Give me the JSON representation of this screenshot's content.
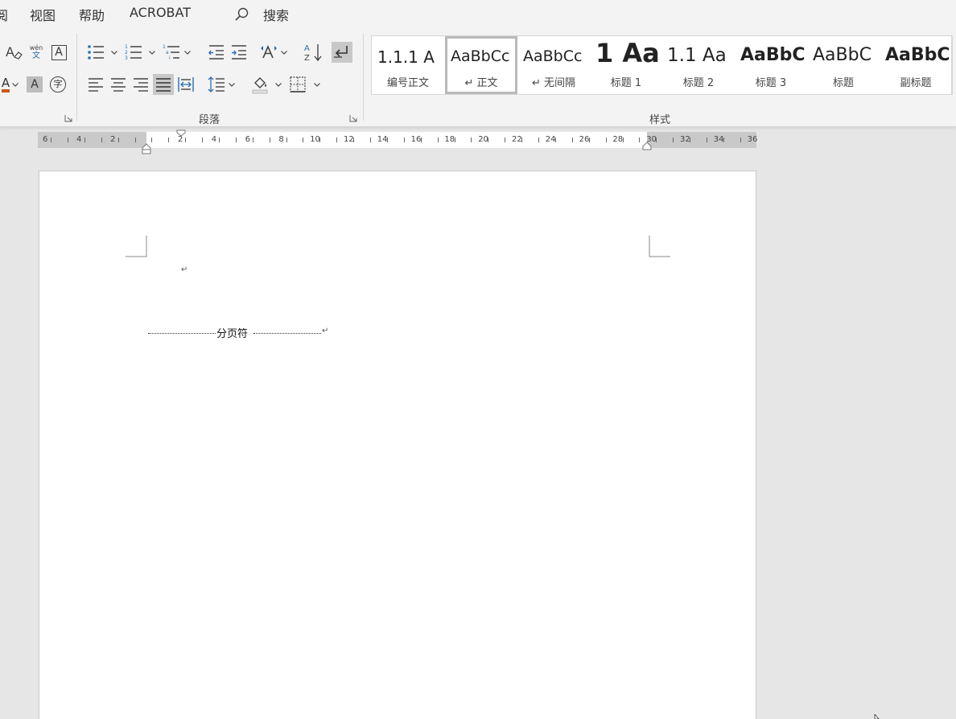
{
  "menu": {
    "items": [
      "阅",
      "视图",
      "帮助",
      "ACROBAT"
    ],
    "search_label": "搜索"
  },
  "ribbon": {
    "paragraph_group_label": "段落",
    "styles_group_label": "样式",
    "font_buttons": {
      "wen_top": "wén",
      "wen_bottom": "文",
      "boxed_a": "A",
      "shaded_a": "A",
      "circled_char": "字",
      "font_color_a": "A"
    },
    "styles": [
      {
        "preview": "1.1.1  A",
        "name": "编号正文",
        "selected": false
      },
      {
        "preview": "AaBbCc",
        "name": "↵ 正文",
        "selected": true
      },
      {
        "preview": "AaBbCc",
        "name": "↵ 无间隔",
        "selected": false
      },
      {
        "preview": "1  Aa",
        "name": "标题 1",
        "selected": false
      },
      {
        "preview": "1.1  Aa",
        "name": "标题 2",
        "selected": false
      },
      {
        "preview": "AaBbC",
        "name": "标题 3",
        "selected": false
      },
      {
        "preview": "AaBbC",
        "name": "标题",
        "selected": false
      },
      {
        "preview": "AaBbC",
        "name": "副标题",
        "selected": false
      }
    ],
    "accent_color": "#c55a11"
  },
  "ruler": {
    "left_labels": [
      "6",
      "4",
      "2"
    ],
    "right_labels": [
      "2",
      "4",
      "6",
      "8",
      "10",
      "12",
      "14",
      "16",
      "18",
      "20",
      "22",
      "24",
      "26",
      "28",
      "30",
      "32",
      "34",
      "36"
    ]
  },
  "document": {
    "paragraph_mark": "↵",
    "page_break_label": "分页符"
  }
}
